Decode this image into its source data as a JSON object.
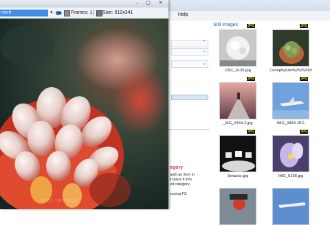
{
  "viewer": {
    "title": "",
    "zoom_value": "retch",
    "frames_label": "Frames: 1",
    "size_label": "Size: 512x341",
    "watermark": "tiles tmr.mtgr"
  },
  "menu": {
    "help_label": "Help"
  },
  "panel": {
    "category_heading": "egory",
    "description_lines": [
      "ault) an item in",
      "ll place it into",
      "ed category.",
      "",
      "essing F3."
    ]
  },
  "gallery": {
    "title": "Still Images",
    "items": [
      {
        "caption": "DSC_6139.jpg",
        "badge": "JPG"
      },
      {
        "caption": "Conophytum%252520cha...",
        "badge": "JPG"
      },
      {
        "caption": "_MG_0334-3.jpg",
        "badge": "JPG"
      },
      {
        "caption": "IMG_9483.JPG",
        "badge": "JPG"
      },
      {
        "caption": "3shacks.jpg",
        "badge": "JPG"
      },
      {
        "caption": "IMG_5158.jpg",
        "badge": "JPG"
      },
      {
        "caption": "",
        "badge": ""
      },
      {
        "caption": "",
        "badge": ""
      }
    ]
  }
}
